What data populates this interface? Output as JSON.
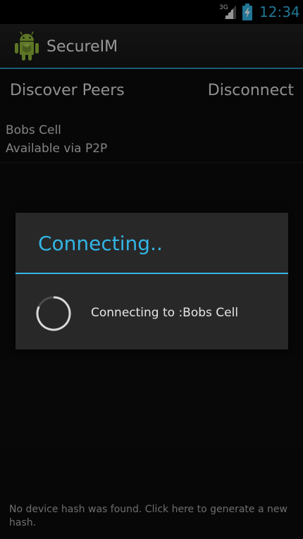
{
  "status_bar": {
    "network_type": "3G",
    "time": "12:34",
    "accent_color": "#33b5e5"
  },
  "action_bar": {
    "app_icon": "android-robot-icon",
    "app_title": "SecureIM"
  },
  "buttons": {
    "discover_label": "Discover Peers",
    "disconnect_label": "Disconnect"
  },
  "peers": [
    {
      "name": "Bobs Cell",
      "status": "Available via P2P"
    }
  ],
  "dialog": {
    "title": "Connecting..",
    "message": "Connecting to :Bobs Cell",
    "spinner_icon": "progress-spinner-icon"
  },
  "footer": {
    "message": "No device hash was found. Click here to generate a new hash."
  }
}
